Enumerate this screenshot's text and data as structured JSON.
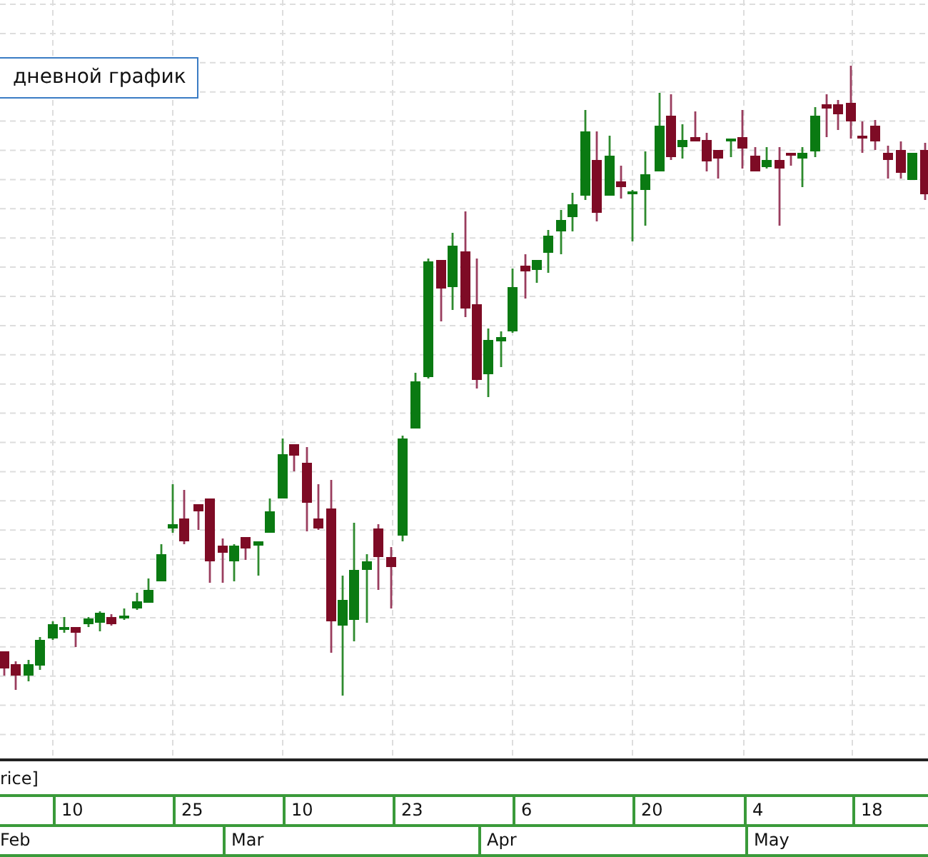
{
  "legend": {
    "label": "дневной график"
  },
  "series_label": "rice]",
  "axis": {
    "days": [
      "10",
      "25",
      "10",
      "23",
      "6",
      "20",
      "4",
      "18"
    ],
    "months": [
      "Feb",
      "Mar",
      "Apr",
      "May"
    ]
  }
}
